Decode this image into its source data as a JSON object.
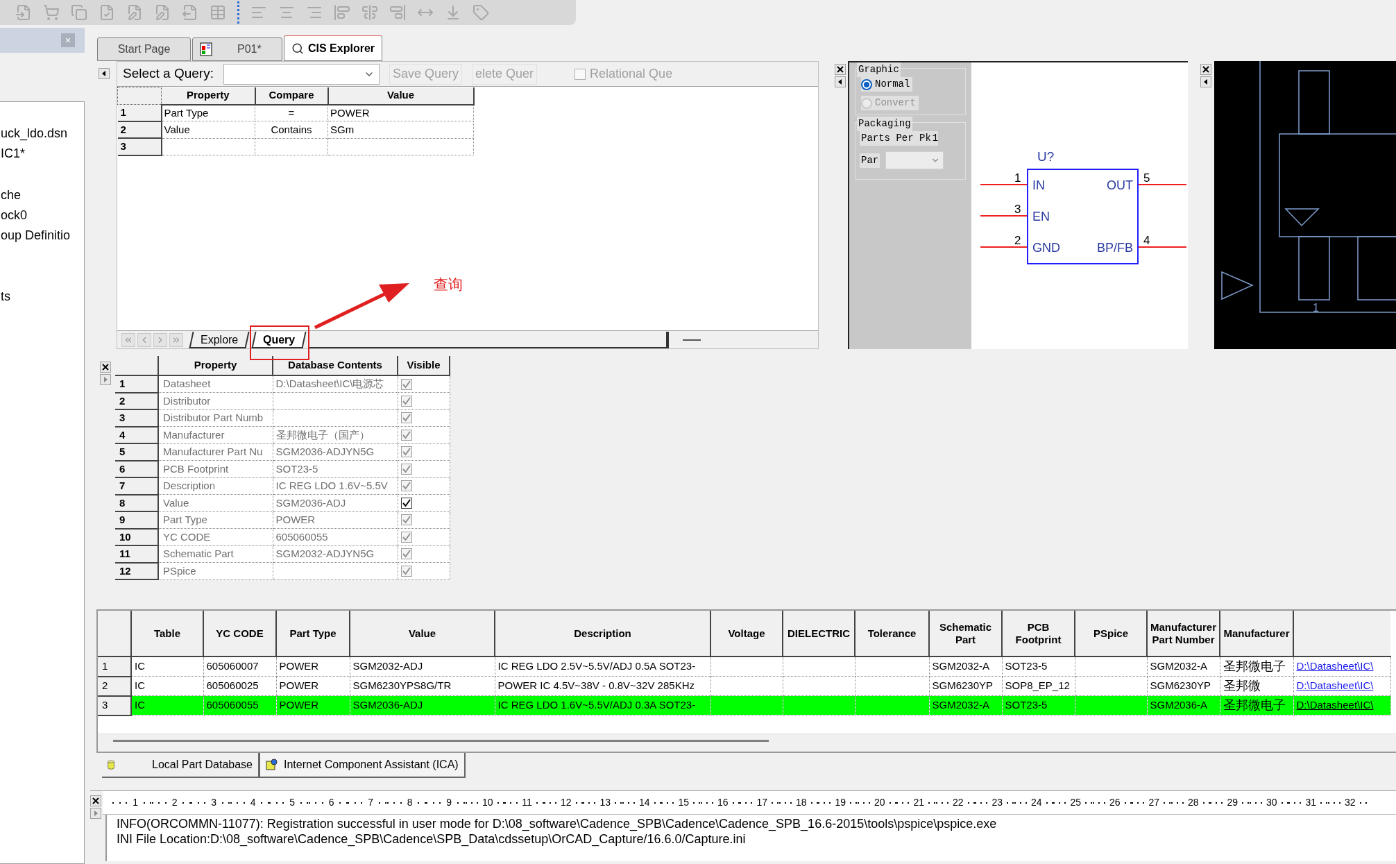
{
  "left_panel": {
    "close": "×",
    "items": [
      "uck_ldo.dsn",
      "IC1*",
      "che",
      "ock0",
      "oup Definitio",
      "ts"
    ]
  },
  "tabs": [
    {
      "label": "Start Page",
      "selected": false,
      "kind": "plain"
    },
    {
      "label": "P01*",
      "selected": false,
      "kind": "schematic"
    },
    {
      "label": "CIS Explorer",
      "selected": true,
      "kind": "explorer"
    }
  ],
  "query": {
    "select_label": "Select a Query:",
    "buttons": [
      {
        "label": "Save Query",
        "disabled": true
      },
      {
        "label": "elete Quer",
        "disabled": true
      }
    ],
    "relational": {
      "label": "Relational Que",
      "checked": false
    },
    "grid": {
      "columns": [
        "Property",
        "Compare",
        "Value"
      ],
      "rows": [
        {
          "number": "1",
          "cells": [
            "Part Type",
            "=",
            "POWER"
          ]
        },
        {
          "number": "2",
          "cells": [
            "Value",
            "Contains",
            "SGm"
          ]
        },
        {
          "number": "3"
        }
      ]
    },
    "sheet_tabs": [
      {
        "label": "Explore",
        "selected": false
      },
      {
        "label": "Query",
        "selected": true
      }
    ],
    "annotation": {
      "label": "查询"
    }
  },
  "graphic": {
    "title": "Graphic",
    "options": [
      {
        "label": "Normal",
        "selected": true,
        "disabled": false
      },
      {
        "label": "Convert",
        "selected": false,
        "disabled": true
      }
    ],
    "packaging_title": "Packaging",
    "parts_per_pkg_label": "Parts Per Pk",
    "parts_per_pkg": "1",
    "part_label": "Par"
  },
  "symbol": {
    "ref": "U?",
    "rows": [
      {
        "left": {
          "number": "1",
          "name": "IN"
        },
        "right": {
          "number": "5",
          "name": "OUT"
        }
      },
      {
        "left": {
          "number": "3",
          "name": "EN"
        }
      },
      {
        "left": {
          "number": "2",
          "name": "GND"
        },
        "right": {
          "number": "4",
          "name": "BP/FB"
        }
      }
    ]
  },
  "footprint": {
    "pin_label": "1"
  },
  "properties": {
    "columns": [
      "Property",
      "Database Contents",
      "Visible"
    ],
    "rows": [
      {
        "number": "1",
        "property": "Datasheet",
        "contents": "D:\\Datasheet\\IC\\电源芯",
        "checked": true,
        "disabled": true
      },
      {
        "number": "2",
        "property": "Distributor",
        "checked": true,
        "disabled": true
      },
      {
        "number": "3",
        "property": "Distributor Part Numb",
        "checked": true,
        "disabled": true
      },
      {
        "number": "4",
        "property": "Manufacturer",
        "contents": "圣邦微电子（国产）",
        "checked": true,
        "disabled": true
      },
      {
        "number": "5",
        "property": "Manufacturer Part Nu",
        "contents": "SGM2036-ADJYN5G",
        "checked": true,
        "disabled": true
      },
      {
        "number": "6",
        "property": "PCB Footprint",
        "contents": "SOT23-5",
        "checked": true,
        "disabled": true
      },
      {
        "number": "7",
        "property": "Description",
        "contents": "IC REG LDO 1.6V~5.5V",
        "checked": true,
        "disabled": true
      },
      {
        "number": "8",
        "property": "Value",
        "contents": "SGM2036-ADJ",
        "checked": true,
        "disabled": false
      },
      {
        "number": "9",
        "property": "Part Type",
        "contents": "POWER",
        "checked": true,
        "disabled": true
      },
      {
        "number": "10",
        "property": "YC CODE",
        "contents": "605060055",
        "checked": true,
        "disabled": true
      },
      {
        "number": "11",
        "property": "Schematic Part",
        "contents": "SGM2032-ADJYN5G",
        "checked": true,
        "disabled": true
      },
      {
        "number": "12",
        "property": "PSpice",
        "checked": true,
        "disabled": true
      }
    ]
  },
  "parts": {
    "columns": [
      "Table",
      "YC CODE",
      "Part Type",
      "Value",
      "Description",
      "Voltage",
      "DIELECTRIC",
      "Tolerance",
      "Schematic Part",
      "PCB Footprint",
      "PSpice",
      "Manufacturer Part Number",
      "Manufacturer"
    ],
    "rows": [
      {
        "number": "1",
        "selected": false,
        "cells": [
          "IC",
          "605060007",
          "POWER",
          "SGM2032-ADJ",
          "IC REG LDO 2.5V~5.5V/ADJ 0.5A SOT23-",
          null,
          null,
          null,
          "SGM2032-A",
          "SOT23-5",
          null,
          "SGM2032-A",
          "圣邦微电子"
        ],
        "datasheet": "D:\\Datasheet\\IC\\"
      },
      {
        "number": "2",
        "selected": false,
        "cells": [
          "IC",
          "605060025",
          "POWER",
          "SGM6230YPS8G/TR",
          "POWER IC 4.5V~38V - 0.8V~32V 285KHz",
          null,
          null,
          null,
          "SGM6230YP",
          "SOP8_EP_12",
          null,
          "SGM6230YP",
          "圣邦微"
        ],
        "datasheet": "D:\\Datasheet\\IC\\"
      },
      {
        "number": "3",
        "selected": true,
        "cells": [
          "IC",
          "605060055",
          "POWER",
          "SGM2036-ADJ",
          "IC REG LDO 1.6V~5.5V/ADJ 0.3A SOT23-",
          null,
          null,
          null,
          "SGM2032-A",
          "SOT23-5",
          null,
          "SGM2036-A",
          "圣邦微电子"
        ],
        "datasheet": "D:\\Datasheet\\IC\\"
      }
    ]
  },
  "bottom_tabs": [
    {
      "label": "Local Part Database",
      "selected": true,
      "kind": "database"
    },
    {
      "label": "Internet Component Assistant (ICA)",
      "selected": false,
      "kind": "ica"
    }
  ],
  "ruler": [
    "1",
    "2",
    "3",
    "4",
    "5",
    "6",
    "7",
    "8",
    "9",
    "10",
    "11",
    "12",
    "13",
    "14",
    "15",
    "16",
    "17",
    "18",
    "19",
    "20",
    "21",
    "22",
    "23",
    "24",
    "25",
    "26",
    "27",
    "28",
    "29",
    "30",
    "31",
    "32"
  ],
  "log": [
    "INFO(ORCOMMN-11077): Registration successful in user mode for D:\\08_software\\Cadence_SPB\\Cadence\\Cadence_SPB_16.6-2015\\tools\\pspice\\pspice.exe",
    "INI File Location:D:\\08_software\\Cadence_SPB\\Cadence\\SPB_Data\\cdssetup\\OrCAD_Capture/16.6.0/Capture.ini"
  ]
}
